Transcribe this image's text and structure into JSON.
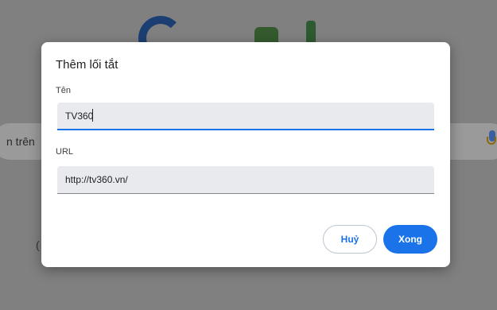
{
  "background": {
    "search_partial_text": "n trên",
    "shortcut_left_glyph": "(",
    "shortcut_right_glyph": ":"
  },
  "dialog": {
    "title": "Thêm lối tắt",
    "name_label": "Tên",
    "name_value": "TV360",
    "url_label": "URL",
    "url_value": "http://tv360.vn/",
    "cancel_label": "Huỷ",
    "done_label": "Xong"
  },
  "icons": {
    "mic": "microphone-icon",
    "logo": "google-logo"
  },
  "colors": {
    "accent": "#1a73e8",
    "field_bg": "#e8eaed",
    "overlay": "#808080"
  }
}
